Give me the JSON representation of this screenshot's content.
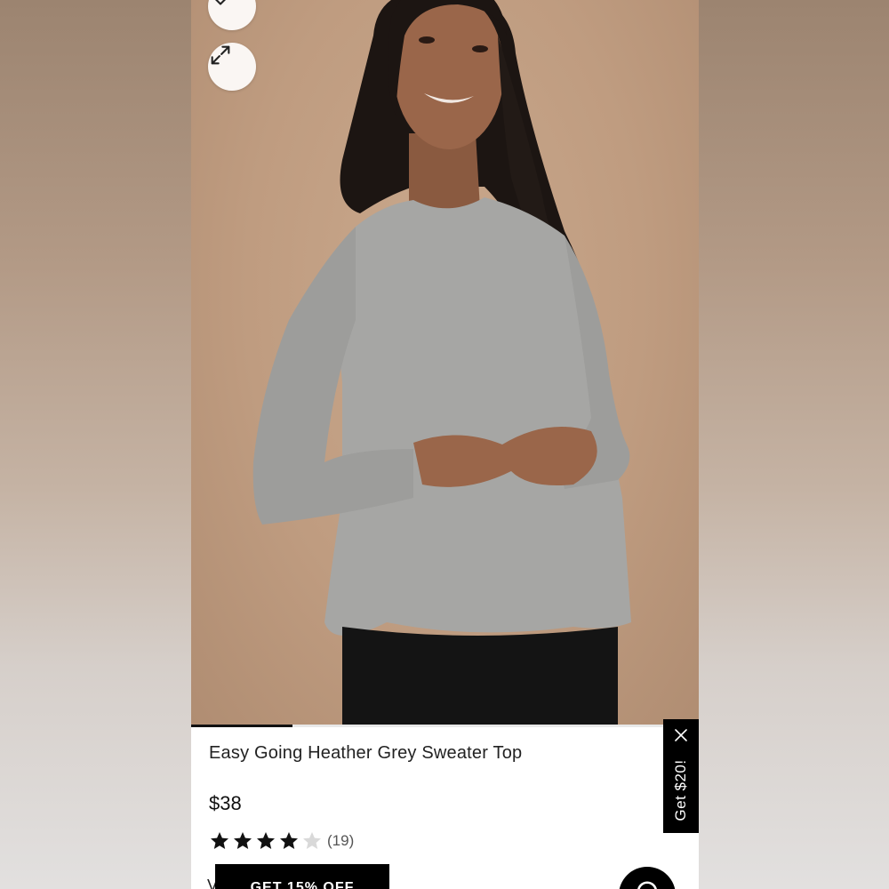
{
  "product": {
    "title": "Easy Going Heather Grey Sweater Top",
    "price": "$38",
    "rating": 4,
    "rating_max": 5,
    "review_count": "(19)",
    "promo_label": "GET 15% OFF",
    "partial_text": "V"
  },
  "gallery": {
    "progress": 0.2
  },
  "side_tab": {
    "label": "Get $20!"
  },
  "icons": {
    "wishlist": "heart-icon",
    "expand": "expand-icon",
    "close": "close-icon",
    "chat": "chat-icon",
    "star": "star-icon"
  },
  "colors": {
    "accent": "#000000",
    "star_filled": "#111111",
    "star_empty": "#d9d9d9"
  }
}
